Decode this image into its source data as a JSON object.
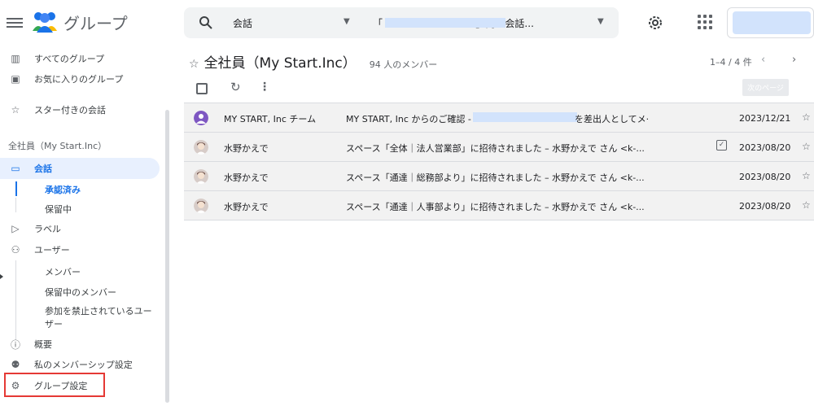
{
  "header": {
    "app_title": "グループ",
    "search_scope": "会話",
    "search_value": "「                              」内の会話...",
    "icons": {
      "menu": "hamburger-menu-icon",
      "logo": "groups-logo-icon",
      "search": "search-icon",
      "settings": "gear-icon",
      "apps": "apps-grid-icon"
    }
  },
  "sidebar": {
    "all_groups": "すべてのグループ",
    "favorite_groups": "お気に入りのグループ",
    "starred": "スター付きの会話",
    "group_name": "全社員（My Start.Inc）",
    "conversations": "会話",
    "approved": "承認済み",
    "pending": "保留中",
    "labels": "ラベル",
    "users": "ユーザー",
    "members": "メンバー",
    "pending_members": "保留中のメンバー",
    "banned_members": "参加を禁止されているユーザー",
    "about": "概要",
    "my_membership": "私のメンバーシップ設定",
    "group_settings": "グループ設定"
  },
  "main": {
    "title": "全社員（My Start.Inc）",
    "member_count": "94 人のメンバー",
    "pager_text": "1–4 / 4 件",
    "next_page": "次のページ",
    "rows": [
      {
        "sender": "MY START, Inc チーム",
        "subject_prefix": "MY START, Inc からのご確認 -",
        "subject_suffix": "を差出人としてメ·",
        "date": "2023/12/21",
        "approved": false
      },
      {
        "sender": "水野かえで",
        "subject_prefix": "スペース「全体｜法人営業部」に招待されました – 水野かえで さん <k-...",
        "subject_suffix": "",
        "date": "2023/08/20",
        "approved": true
      },
      {
        "sender": "水野かえで",
        "subject_prefix": "スペース「通達｜総務部より」に招待されました – 水野かえで さん <k-...",
        "subject_suffix": "",
        "date": "2023/08/20",
        "approved": false
      },
      {
        "sender": "水野かえで",
        "subject_prefix": "スペース「通達｜人事部より」に招待されました – 水野かえで さん <k-...",
        "subject_suffix": "",
        "date": "2023/08/20",
        "approved": false
      }
    ]
  },
  "colors": {
    "accent": "#1a73e8",
    "active_bg": "#e8f0fe",
    "highlight": "#e53935",
    "row_bg": "#f2f2f2"
  }
}
